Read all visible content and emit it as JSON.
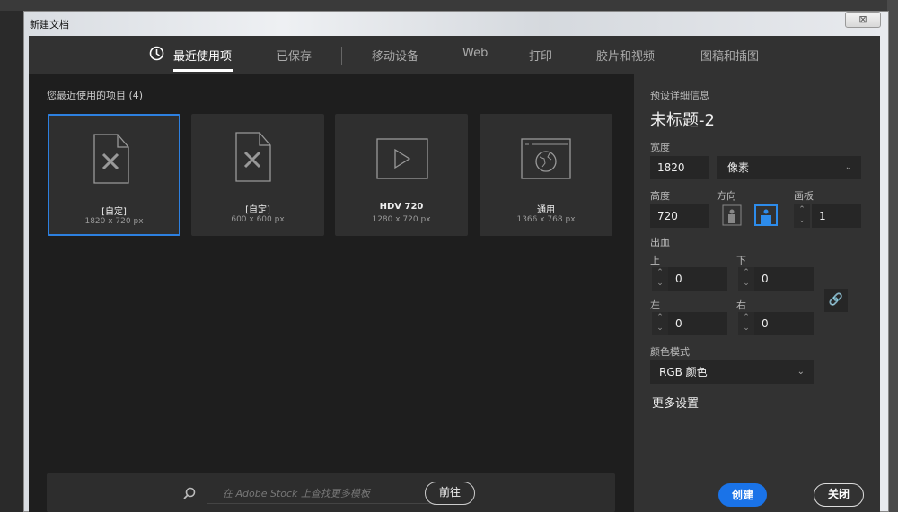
{
  "window": {
    "title": "新建文档",
    "close": "⊠"
  },
  "tabs": [
    {
      "label": "最近使用项",
      "active": true
    },
    {
      "label": "已保存"
    },
    {
      "label": "移动设备"
    },
    {
      "label": "Web"
    },
    {
      "label": "打印"
    },
    {
      "label": "胶片和视频"
    },
    {
      "label": "图稿和插图"
    }
  ],
  "recent": {
    "heading": "您最近使用的项目  (4)",
    "items": [
      {
        "name": "[自定]",
        "size": "1820 x 720 px",
        "icon": "custom-doc-icon",
        "selected": true
      },
      {
        "name": "[自定]",
        "size": "600 x 600 px",
        "icon": "custom-doc-icon"
      },
      {
        "name": "HDV 720",
        "size": "1280 x 720 px",
        "icon": "video-icon"
      },
      {
        "name": "通用",
        "size": "1366 x 768 px",
        "icon": "web-globe-icon"
      }
    ]
  },
  "stock": {
    "placeholder": "在 Adobe Stock 上查找更多模板",
    "go": "前往"
  },
  "details": {
    "heading": "预设详细信息",
    "name": "未标题-2",
    "width_label": "宽度",
    "width": "1820",
    "unit": "像素",
    "height_label": "高度",
    "height": "720",
    "orientation_label": "方向",
    "orientation": "landscape",
    "artboards_label": "画板",
    "artboards": "1",
    "bleed_label": "出血",
    "top_label": "上",
    "top": "0",
    "bottom_label": "下",
    "bottom": "0",
    "left_label": "左",
    "left": "0",
    "right_label": "右",
    "right": "0",
    "color_mode_label": "颜色模式",
    "color_mode": "RGB 颜色",
    "more": "更多设置"
  },
  "buttons": {
    "create": "创建",
    "close": "关闭"
  },
  "colors": {
    "accent": "#1a73e8"
  }
}
